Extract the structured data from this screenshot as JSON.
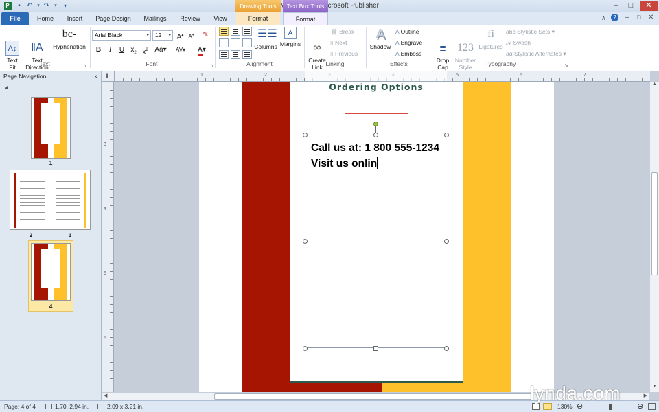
{
  "window": {
    "title": "Menu2.pub - Microsoft Publisher",
    "contextual_tabs": [
      "Drawing Tools",
      "Text Box Tools"
    ],
    "controls": [
      "–",
      "□",
      "✕"
    ],
    "ribbon_controls": [
      "∧",
      "?",
      "–",
      "□",
      "✕"
    ]
  },
  "tabs": [
    "File",
    "Home",
    "Insert",
    "Page Design",
    "Mailings",
    "Review",
    "View",
    "Format",
    "Format"
  ],
  "ribbon": {
    "text_group": {
      "label": "Text",
      "text_fit": "Text\nFit",
      "text_direction": "Text\nDirection",
      "hyphenation": "Hyphenation"
    },
    "font_group": {
      "label": "Font",
      "font_name": "Arial Black",
      "font_size": "12"
    },
    "alignment_group": {
      "label": "Alignment",
      "columns": "Columns",
      "margins": "Margins"
    },
    "linking_group": {
      "label": "Linking",
      "create_link": "Create\nLink",
      "break": "Break",
      "next": "Next",
      "previous": "Previous"
    },
    "effects_group": {
      "label": "Effects",
      "shadow": "Shadow",
      "outline": "Outline",
      "engrave": "Engrave",
      "emboss": "Emboss"
    },
    "typography_group": {
      "label": "Typography",
      "drop_cap": "Drop\nCap",
      "number_style": "Number\nStyle",
      "ligatures": "Ligatures",
      "stylistic_sets": "Stylistic Sets",
      "swash": "Swash",
      "stylistic_alternates": "Stylistic Alternates"
    }
  },
  "nav": {
    "title": "Page Navigation",
    "pages": [
      {
        "num": "1"
      },
      {
        "num": "2"
      },
      {
        "num": "3"
      },
      {
        "num": "4"
      }
    ]
  },
  "rulers": {
    "h_marks": [
      "1",
      "2",
      "3",
      "4",
      "5",
      "6",
      "7"
    ],
    "v_marks": [
      "3",
      "4",
      "5",
      "6"
    ]
  },
  "document": {
    "heading": "Ordering Options",
    "textbox_lines": [
      "Call us at: 1 800 555-1234",
      "Visit us onlin"
    ],
    "colors": {
      "red": "#a51502",
      "yellow": "#fec12b",
      "teal": "#2e5a4e"
    }
  },
  "status": {
    "page": "Page: 4 of 4",
    "position": "1.70, 2.94 in.",
    "size": "2.09 x 3.21 in.",
    "zoom": "130%"
  },
  "watermark": "lynda.com"
}
